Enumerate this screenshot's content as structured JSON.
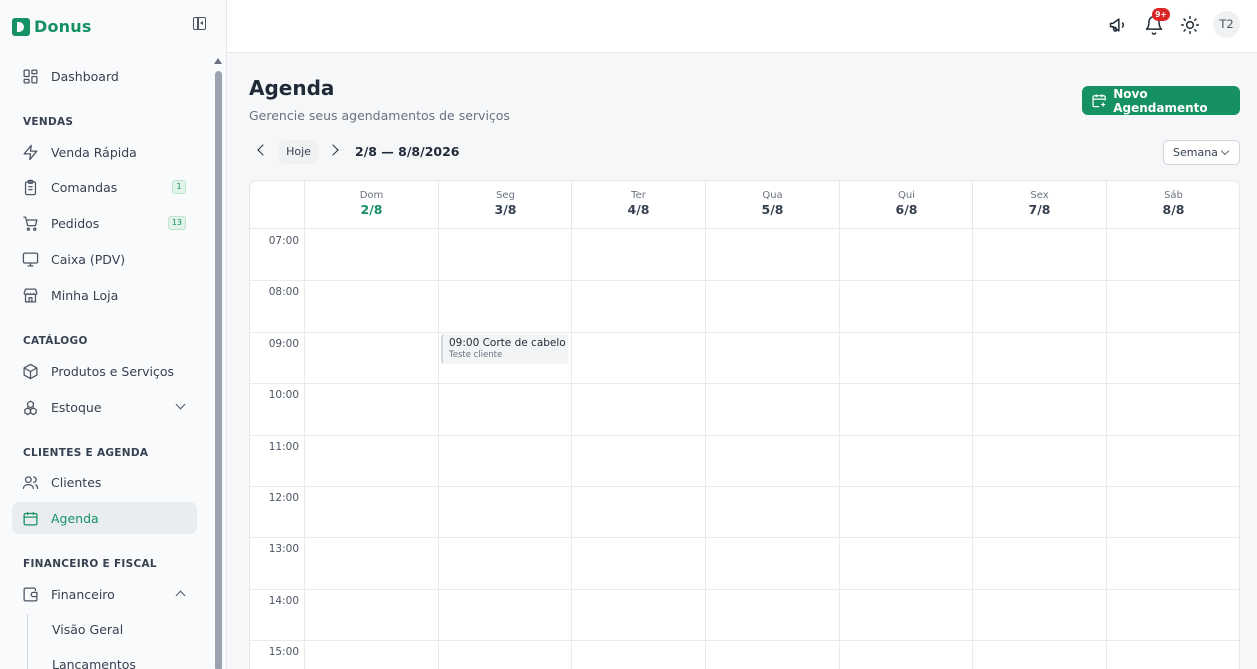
{
  "app": {
    "name": "Donus"
  },
  "sidebar": {
    "items": {
      "dashboard": "Dashboard",
      "venda_rapida": "Venda Rápida",
      "comandas": "Comandas",
      "pedidos": "Pedidos",
      "caixa": "Caixa (PDV)",
      "minha_loja": "Minha Loja",
      "produtos": "Produtos e Serviços",
      "estoque": "Estoque",
      "clientes": "Clientes",
      "agenda": "Agenda",
      "financeiro": "Financeiro",
      "visao_geral": "Visão Geral",
      "lancamentos": "Lançamentos"
    },
    "badges": {
      "comandas": "1",
      "pedidos": "13"
    },
    "sections": {
      "vendas": "VENDAS",
      "catalogo": "CATÁLOGO",
      "clientes_agenda": "CLIENTES E AGENDA",
      "financeiro_fiscal": "FINANCEIRO E FISCAL"
    },
    "active": "agenda"
  },
  "topbar": {
    "notification_badge": "9+",
    "avatar_initials": "T2"
  },
  "page": {
    "title": "Agenda",
    "subtitle": "Gerencie seus agendamentos de serviços",
    "new_button": "Novo Agendamento"
  },
  "toolbar": {
    "today_button": "Hoje",
    "range": "2/8 — 8/8/2026",
    "view_select": "Semana"
  },
  "calendar": {
    "days": [
      {
        "name": "Dom",
        "date": "2/8",
        "today": true
      },
      {
        "name": "Seg",
        "date": "3/8"
      },
      {
        "name": "Ter",
        "date": "4/8"
      },
      {
        "name": "Qua",
        "date": "5/8"
      },
      {
        "name": "Qui",
        "date": "6/8"
      },
      {
        "name": "Sex",
        "date": "7/8"
      },
      {
        "name": "Sáb",
        "date": "8/8"
      }
    ],
    "hours": [
      "07:00",
      "08:00",
      "09:00",
      "10:00",
      "11:00",
      "12:00",
      "13:00",
      "14:00",
      "15:00"
    ],
    "events": [
      {
        "title": "09:00 Corte de cabelo",
        "client": "Teste cliente",
        "day": "Seg",
        "start": "09:00"
      }
    ]
  },
  "colors": {
    "brand": "#169163",
    "danger": "#dc2626"
  }
}
